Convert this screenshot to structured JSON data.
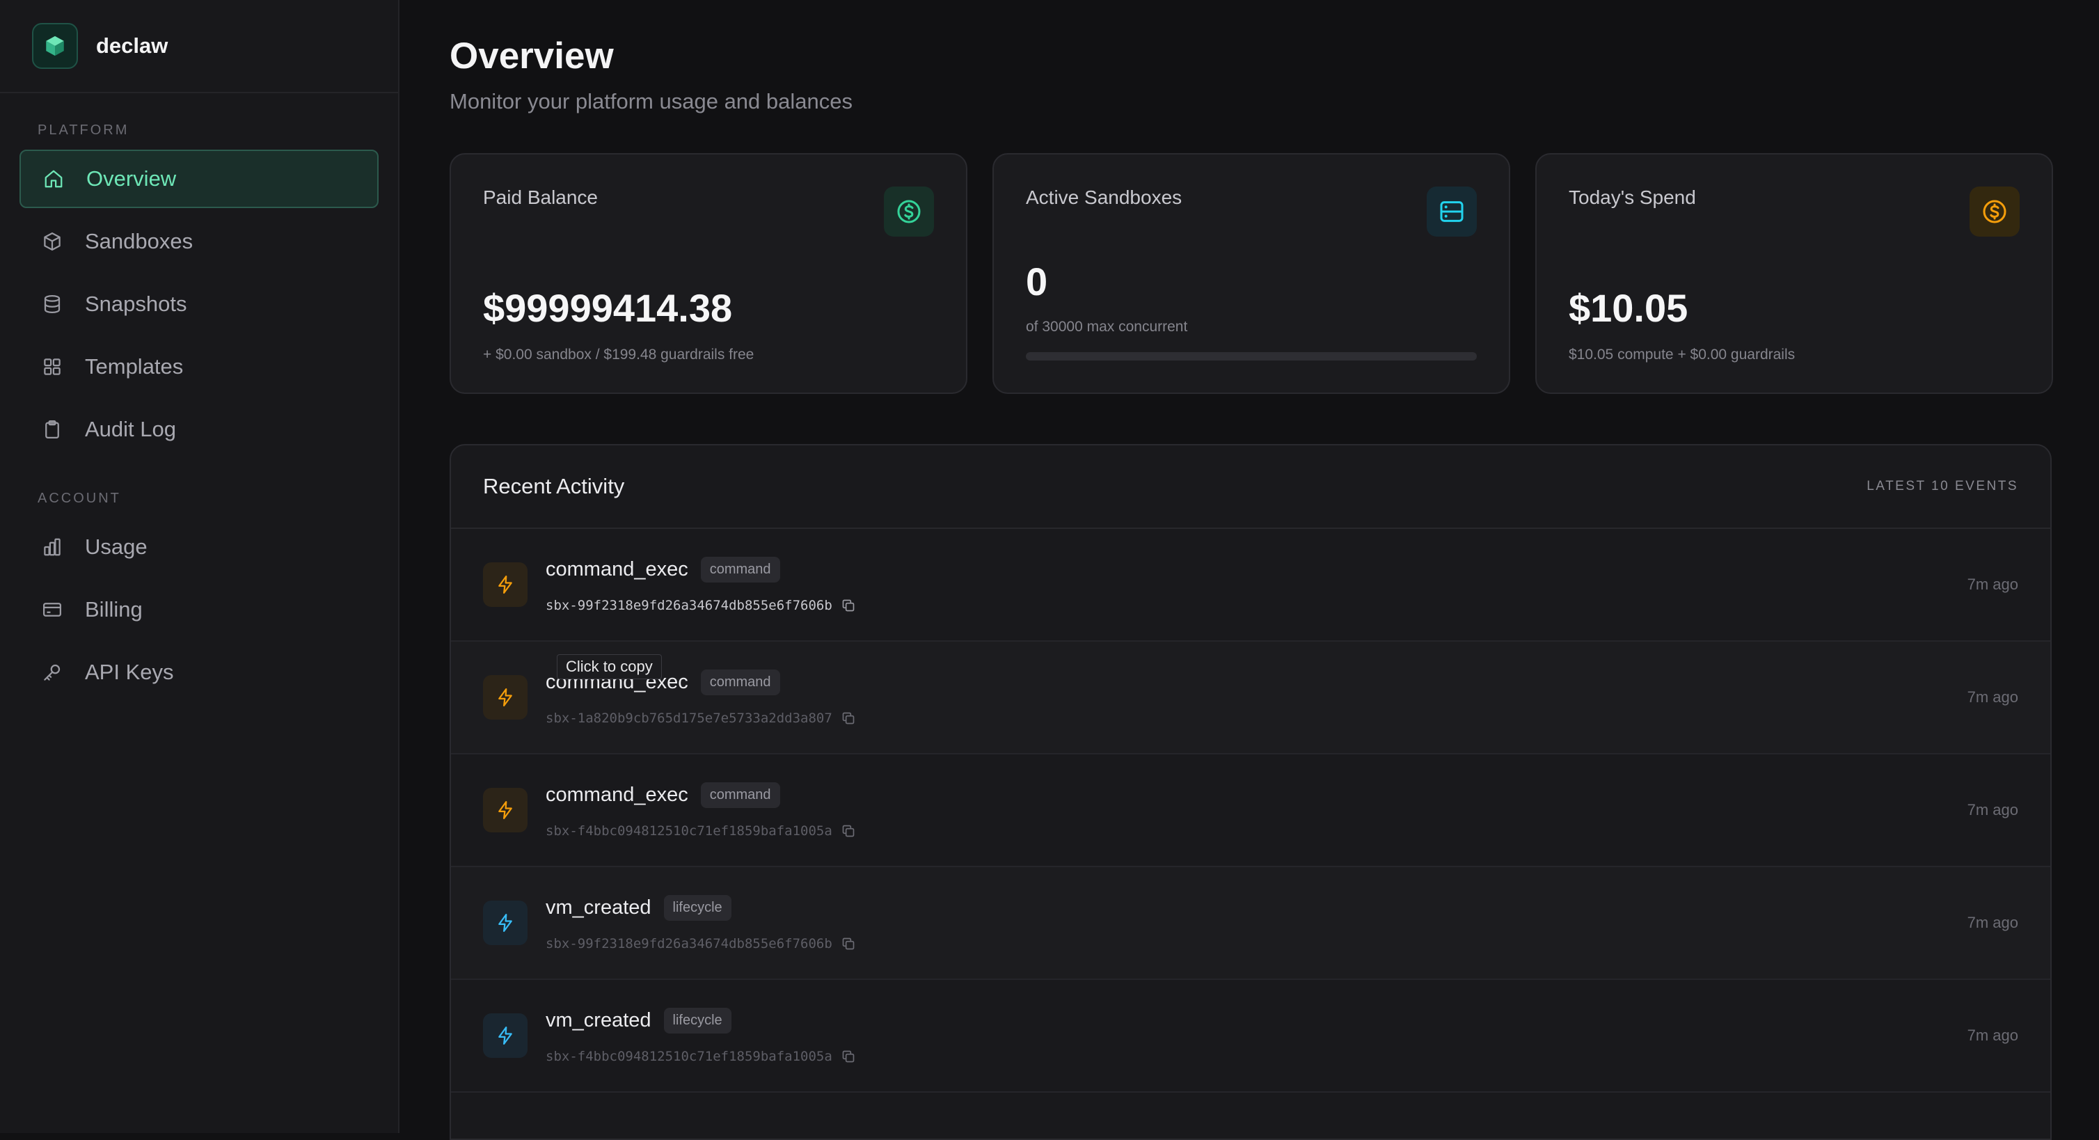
{
  "brand": {
    "name": "declaw"
  },
  "sidebar": {
    "sections": [
      {
        "title": "PLATFORM",
        "items": [
          {
            "label": "Overview",
            "icon": "home-icon",
            "active": true
          },
          {
            "label": "Sandboxes",
            "icon": "cube-icon"
          },
          {
            "label": "Snapshots",
            "icon": "database-icon"
          },
          {
            "label": "Templates",
            "icon": "grid-icon"
          },
          {
            "label": "Audit Log",
            "icon": "clipboard-icon"
          }
        ]
      },
      {
        "title": "ACCOUNT",
        "items": [
          {
            "label": "Usage",
            "icon": "bar-chart-icon"
          },
          {
            "label": "Billing",
            "icon": "credit-card-icon"
          },
          {
            "label": "API Keys",
            "icon": "key-icon"
          }
        ]
      }
    ]
  },
  "header": {
    "title": "Overview",
    "subtitle": "Monitor your platform usage and balances"
  },
  "cards": {
    "paid_balance": {
      "title": "Paid Balance",
      "value": "$99999414.38",
      "sub": "+ $0.00 sandbox / $199.48 guardrails free",
      "icon": "dollar-circle-icon",
      "accent": "#34d399"
    },
    "active_sandboxes": {
      "title": "Active Sandboxes",
      "value": "0",
      "sub": "of 30000 max concurrent",
      "icon": "server-icon",
      "accent": "#22d3ee",
      "progress": 0
    },
    "todays_spend": {
      "title": "Today's Spend",
      "value": "$10.05",
      "sub": "$10.05 compute + $0.00 guardrails",
      "icon": "dollar-circle-icon",
      "accent": "#f59e0b"
    }
  },
  "activity": {
    "title": "Recent Activity",
    "meta": "LATEST 10 EVENTS",
    "rows": [
      {
        "name": "command_exec",
        "tag": "command",
        "id": "sbx-99f2318e9fd26a34674db855e6f7606b",
        "time": "7m ago",
        "kind": "command"
      },
      {
        "name": "command_exec",
        "tag": "command",
        "id": "sbx-1a820b9cb765d175e7e5733a2dd3a807",
        "time": "7m ago",
        "kind": "command"
      },
      {
        "name": "command_exec",
        "tag": "command",
        "id": "sbx-f4bbc094812510c71ef1859bafa1005a",
        "time": "7m ago",
        "kind": "command"
      },
      {
        "name": "vm_created",
        "tag": "lifecycle",
        "id": "sbx-99f2318e9fd26a34674db855e6f7606b",
        "time": "7m ago",
        "kind": "lifecycle"
      },
      {
        "name": "vm_created",
        "tag": "lifecycle",
        "id": "sbx-f4bbc094812510c71ef1859bafa1005a",
        "time": "7m ago",
        "kind": "lifecycle"
      }
    ]
  },
  "tooltip": {
    "text": "Click to copy"
  },
  "colors": {
    "command": "#f59e0b",
    "lifecycle": "#38bdf8",
    "accent_green": "#6ee7b7"
  }
}
